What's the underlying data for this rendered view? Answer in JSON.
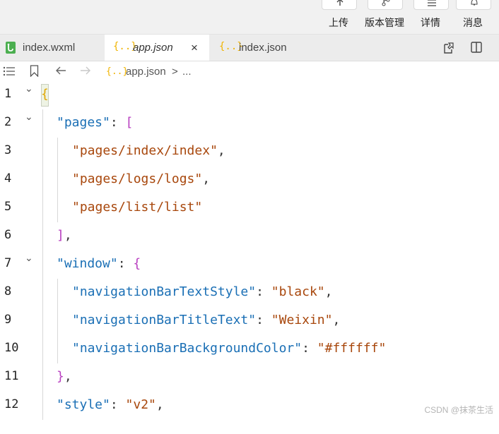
{
  "toolbar": {
    "items": [
      {
        "label": "上传",
        "icon": "upload-icon"
      },
      {
        "label": "版本管理",
        "icon": "branch-icon"
      },
      {
        "label": "详情",
        "icon": "menu-icon"
      },
      {
        "label": "消息",
        "icon": "bell-icon"
      }
    ]
  },
  "tabs": [
    {
      "label": "index.wxml",
      "icon": "wxml-file-icon",
      "active": false
    },
    {
      "label": "app.json",
      "icon": "json-file-icon",
      "active": true,
      "close": "×"
    },
    {
      "label": "index.json",
      "icon": "json-file-icon",
      "active": false
    }
  ],
  "breadcrumb": {
    "icon_glyph": "{..}",
    "file": "app.json",
    "separator": ">",
    "more": "..."
  },
  "editor": {
    "lines": [
      {
        "n": "1"
      },
      {
        "n": "2"
      },
      {
        "n": "3"
      },
      {
        "n": "4"
      },
      {
        "n": "5"
      },
      {
        "n": "6"
      },
      {
        "n": "7"
      },
      {
        "n": "8"
      },
      {
        "n": "9"
      },
      {
        "n": "10"
      },
      {
        "n": "11"
      },
      {
        "n": "12"
      }
    ],
    "tokens": {
      "l1_open": "{",
      "l2_key": "\"pages\"",
      "l2_colon": ": ",
      "l2_open": "[",
      "l3_val": "\"pages/index/index\"",
      "l3_comma": ",",
      "l4_val": "\"pages/logs/logs\"",
      "l4_comma": ",",
      "l5_val": "\"pages/list/list\"",
      "l6_close": "]",
      "l6_comma": ",",
      "l7_key": "\"window\"",
      "l7_colon": ": ",
      "l7_open": "{",
      "l8_key": "\"navigationBarTextStyle\"",
      "l8_colon": ": ",
      "l8_val": "\"black\"",
      "l8_comma": ",",
      "l9_key": "\"navigationBarTitleText\"",
      "l9_colon": ": ",
      "l9_val": "\"Weixin\"",
      "l9_comma": ",",
      "l10_key": "\"navigationBarBackgroundColor\"",
      "l10_colon": ": ",
      "l10_val": "\"#ffffff\"",
      "l11_close": "}",
      "l11_comma": ",",
      "l12_key": "\"style\"",
      "l12_colon": ": ",
      "l12_val": "\"v2\"",
      "l12_comma": ","
    }
  },
  "watermark": "CSDN @抹茶生活",
  "colors": {
    "key": "#1a6fb5",
    "string": "#a8470c",
    "bracket": "#b83fc0",
    "brace": "#e0a600",
    "wxml_icon": "#4caf50",
    "json_icon": "#f0b400"
  }
}
